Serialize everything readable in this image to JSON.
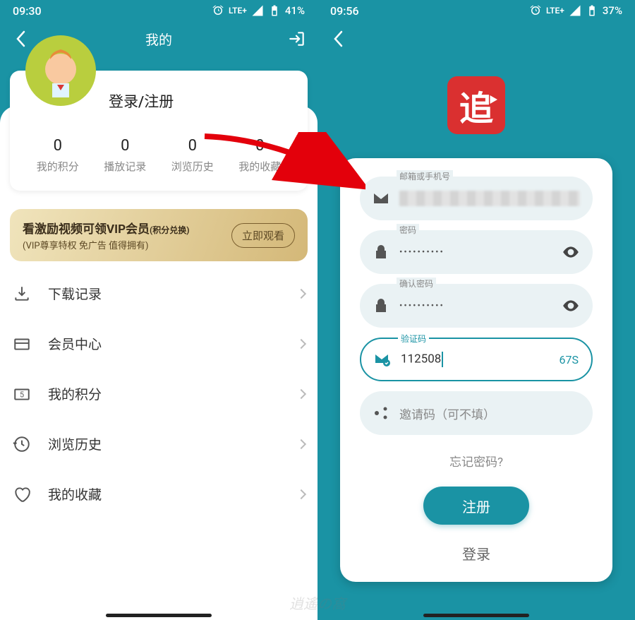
{
  "left": {
    "status": {
      "time": "09:30",
      "lte": "LTE+",
      "battery": "41%"
    },
    "topbar": {
      "title": "我的"
    },
    "profile": {
      "login_text": "登录/注册"
    },
    "stats": [
      {
        "num": "0",
        "lbl": "我的积分"
      },
      {
        "num": "0",
        "lbl": "播放记录"
      },
      {
        "num": "0",
        "lbl": "浏览历史"
      },
      {
        "num": "0",
        "lbl": "我的收藏"
      }
    ],
    "vip": {
      "main": "看激励视频可领VIP会员",
      "tag": "(积分兑换)",
      "sub": "(VIP尊享特权 免广告 值得拥有)",
      "btn": "立即观看"
    },
    "menu": [
      {
        "label": "下载记录"
      },
      {
        "label": "会员中心"
      },
      {
        "label": "我的积分"
      },
      {
        "label": "浏览历史"
      },
      {
        "label": "我的收藏"
      }
    ]
  },
  "right": {
    "status": {
      "time": "09:56",
      "lte": "LTE+",
      "battery": "37%"
    },
    "logo_text": "追",
    "fields": {
      "email_label": "邮箱或手机号",
      "pwd_label": "密码",
      "pwd_value": "••••••••••",
      "cpwd_label": "确认密码",
      "cpwd_value": "••••••••••",
      "code_label": "验证码",
      "code_value": "112508",
      "code_countdown": "67S",
      "invite_placeholder": "邀请码（可不填）"
    },
    "forgot": "忘记密码?",
    "submit": "注册",
    "login": "登录"
  },
  "watermark": "逍遙の窩"
}
